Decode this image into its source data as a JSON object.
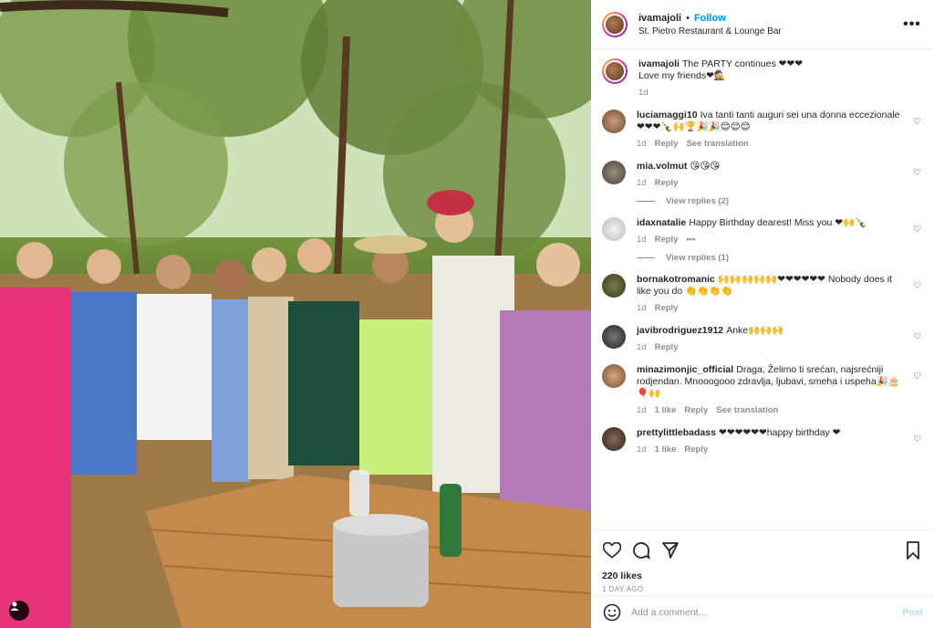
{
  "post": {
    "username": "ivamajoli",
    "separator": "•",
    "follow_label": "Follow",
    "location": "St. Pietro Restaurant & Lounge Bar",
    "more_icon": "more-horizontal-icon",
    "user_tag_icon": "person-icon"
  },
  "caption": {
    "username": "ivamajoli",
    "text": "The PARTY continues ❤❤❤",
    "text2": "Love my friends❤🕵",
    "time": "1d"
  },
  "comments": [
    {
      "username": "luciamaggi10",
      "text": "Iva tanti tanti auguri sei una donna eccezionale ❤❤❤🍾🙌🏆🎉🎉😊😊😊",
      "time": "1d",
      "reply": "Reply",
      "extra": "See translation"
    },
    {
      "username": "mia.volmut",
      "text": "😘😘😘",
      "time": "1d",
      "reply": "Reply",
      "view_replies": "View replies (2)"
    },
    {
      "username": "idaxnatalie",
      "text": "Happy Birthday dearest! Miss you ❤🙌🍾",
      "time": "1d",
      "reply": "Reply",
      "extra": "•••",
      "view_replies": "View replies (1)"
    },
    {
      "username": "bornakotromanic",
      "text": "🙌🙌🙌🙌🙌❤❤❤❤❤❤ Nobody does it like you do 👏👏👏👏",
      "time": "1d",
      "reply": "Reply"
    },
    {
      "username": "javibrodriguez1912",
      "text": "Anke🙌🙌🙌",
      "time": "1d",
      "reply": "Reply"
    },
    {
      "username": "minazimonjic_official",
      "text": "Draga, Želimo ti srećan, najsrećniji rodjendan. Mnooogooo zdravlja, ljubavi, smeha i uspeha🎉🎂🎈🙌",
      "time": "1d",
      "likes": "1 like",
      "reply": "Reply",
      "extra": "See translation"
    },
    {
      "username": "prettylittlebadass",
      "text": "❤❤❤❤❤❤happy birthday ❤",
      "time": "1d",
      "likes": "1 like",
      "reply": "Reply"
    }
  ],
  "actions": {
    "like_icon": "heart-icon",
    "comment_icon": "comment-icon",
    "share_icon": "share-icon",
    "save_icon": "bookmark-icon",
    "likes": "220 likes",
    "ago": "1 DAY AGO"
  },
  "add_comment": {
    "placeholder": "Add a comment…",
    "post_label": "Post",
    "emoji_icon": "emoji-icon"
  }
}
